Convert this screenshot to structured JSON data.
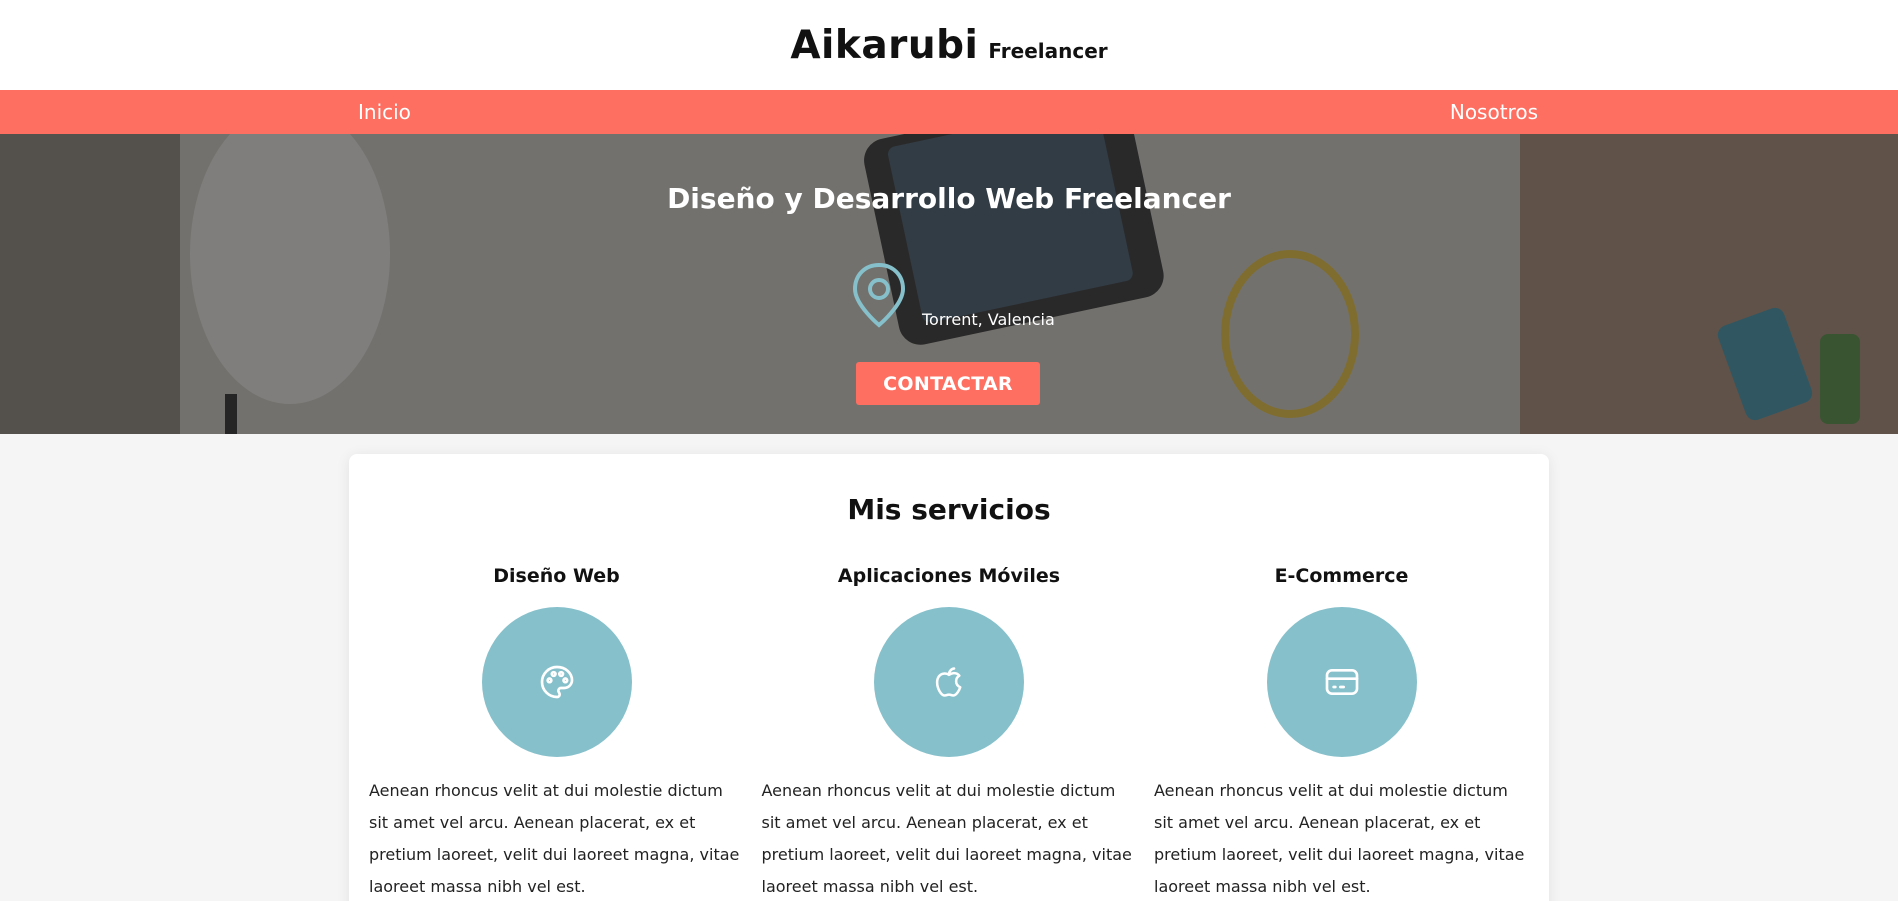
{
  "header": {
    "brand_name": "Aikarubi",
    "brand_sub": "Freelancer"
  },
  "nav": {
    "items": [
      {
        "label": "Inicio"
      },
      {
        "label": "Nosotros"
      }
    ]
  },
  "hero": {
    "title": "Diseño y Desarrollo Web Freelancer",
    "location": "Torrent, Valencia",
    "location_icon": "map-pin-icon",
    "cta_label": "CONTACTAR"
  },
  "services": {
    "title": "Mis servicios",
    "items": [
      {
        "name": "Diseño Web",
        "icon": "palette-icon",
        "text": "Aenean rhoncus velit at dui molestie dictum sit amet vel arcu. Aenean placerat, ex et pretium laoreet, velit dui laoreet magna, vitae laoreet massa nibh vel est."
      },
      {
        "name": "Aplicaciones Móviles",
        "icon": "apple-icon",
        "text": "Aenean rhoncus velit at dui molestie dictum sit amet vel arcu. Aenean placerat, ex et pretium laoreet, velit dui laoreet magna, vitae laoreet massa nibh vel est."
      },
      {
        "name": "E-Commerce",
        "icon": "credit-card-icon",
        "text": "Aenean rhoncus velit at dui molestie dictum sit amet vel arcu. Aenean placerat, ex et pretium laoreet, velit dui laoreet magna, vitae laoreet massa nibh vel est."
      }
    ]
  },
  "colors": {
    "accent": "#ff6f61",
    "service_circle": "#86c0cb",
    "pin": "#86c0cb"
  }
}
